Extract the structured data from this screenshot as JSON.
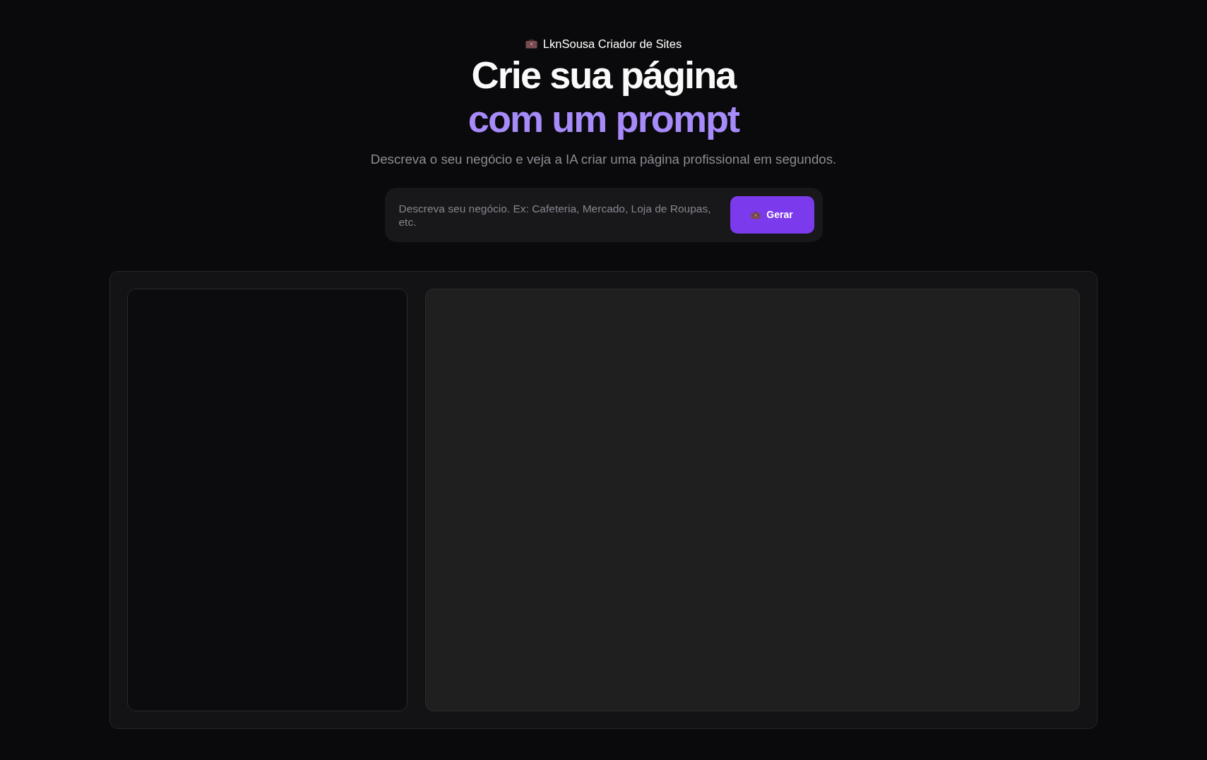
{
  "brand": {
    "text": "LknSousa Criador de Sites"
  },
  "heading": {
    "line_1": "Crie sua página",
    "line_2": "com um prompt"
  },
  "subtitle": "Descreva o seu negócio e veja a IA criar uma página profissional em segundos.",
  "prompt": {
    "placeholder": "Descreva seu negócio. Ex: Cafeteria, Mercado, Loja de Roupas, etc."
  },
  "generate_button": {
    "label": "Gerar"
  }
}
